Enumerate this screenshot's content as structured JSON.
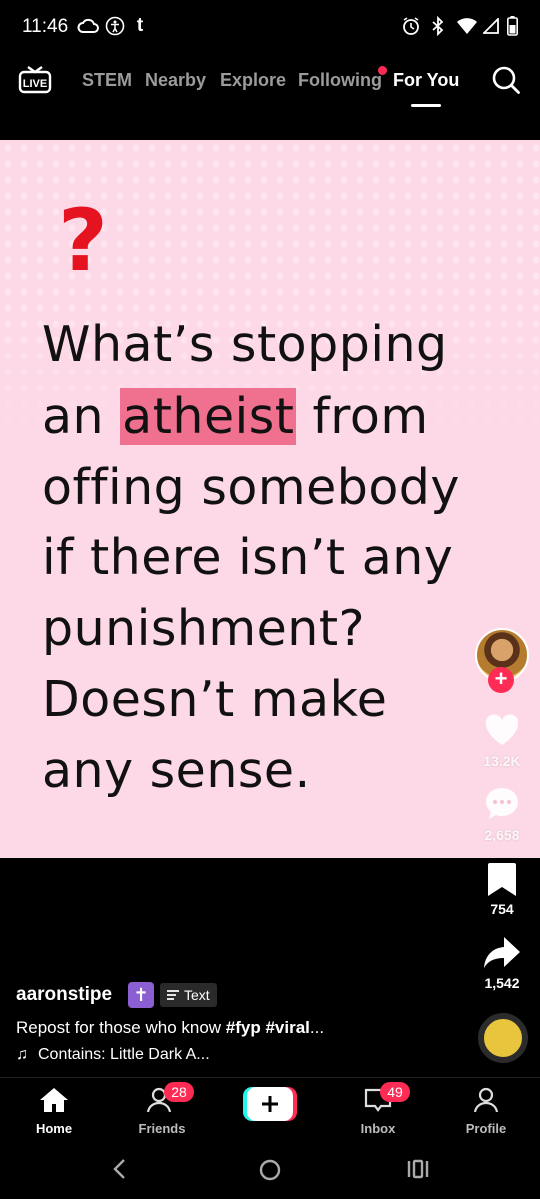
{
  "status_bar": {
    "time": "11:46",
    "left_icons": [
      "cloud-icon",
      "accessibility-icon",
      "tumblr-icon"
    ],
    "right_icons": [
      "alarm-icon",
      "bluetooth-icon",
      "wifi-icon",
      "signal-icon",
      "battery-icon"
    ]
  },
  "top_nav": {
    "live_label": "LIVE",
    "tabs": [
      {
        "label": "STEM",
        "active": false
      },
      {
        "label": "Nearby",
        "active": false
      },
      {
        "label": "Explore",
        "active": false
      },
      {
        "label": "Following",
        "active": false,
        "dot": true
      },
      {
        "label": "For You",
        "active": true
      }
    ]
  },
  "video": {
    "question_mark": "?",
    "caption_lines": [
      "What’s stopping",
      "an ",
      "offing somebody",
      "if there isn’t any",
      "punishment?",
      "Doesn’t make",
      "any sense."
    ],
    "highlight_word": "atheist",
    "line2_tail": " from",
    "background_color": "#fdd8e6",
    "highlight_color": "#f0718f"
  },
  "actions": {
    "likes": "13.2K",
    "comments": "2,658",
    "bookmarks": "754",
    "shares": "1,542"
  },
  "info": {
    "author": "aaronstipe",
    "author_badge": "✝",
    "text_badge": "Text",
    "description_text": "Repost for those who know ",
    "hashtags": "#fyp #viral",
    "description_ellipsis": "...",
    "music": "Contains: Little Dark A..."
  },
  "bottom_nav": {
    "home": "Home",
    "friends": "Friends",
    "friends_badge": "28",
    "inbox": "Inbox",
    "inbox_badge": "49",
    "profile": "Profile",
    "accent": "#fe2c55"
  }
}
